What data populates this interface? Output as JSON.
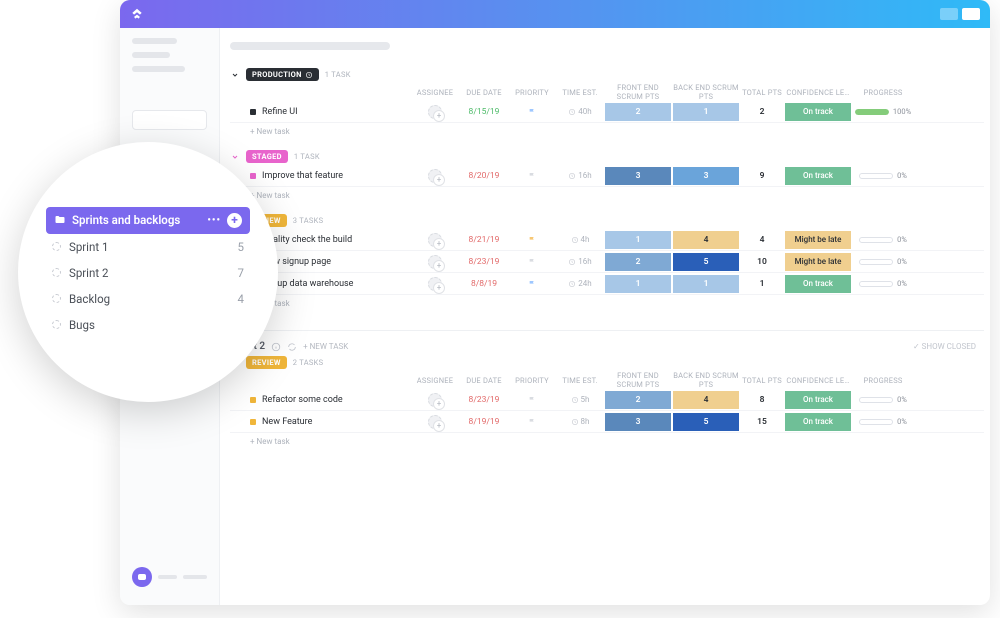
{
  "columns": {
    "assignee": "ASSIGNEE",
    "due": "DUE DATE",
    "priority": "PRIORITY",
    "time": "TIME EST.",
    "fe": "FRONT END SCRUM PTS",
    "be": "BACK END SCRUM PTS",
    "total": "TOTAL PTS",
    "conf": "CONFIDENCE LE…",
    "prog": "PROGRESS"
  },
  "new_task": "+ New task",
  "sprint1_groups": [
    {
      "pill": "PRODUCTION",
      "pill_color": "#2a2e34",
      "pill_arrow": "#2a2e34",
      "count": "1 TASK",
      "tasks": [
        {
          "dot": "#2a2e34",
          "title": "Refine UI",
          "due": "8/15/19",
          "due_cls": "date-green",
          "flag": "#9ec7ff",
          "time": "40h",
          "fe": {
            "v": "2",
            "cls": "fe-lt"
          },
          "be": {
            "v": "1",
            "cls": "be-lt"
          },
          "total": "2",
          "conf": "On track",
          "conf_cls": "conf-track",
          "prog": 100,
          "prog_txt": "100%"
        }
      ]
    },
    {
      "pill": "STAGED",
      "pill_color": "#e864cc",
      "pill_arrow": "#e864cc",
      "count": "1 TASK",
      "tasks": [
        {
          "dot": "#e864cc",
          "title": "Improve that feature",
          "due": "8/20/19",
          "due_cls": "date-red",
          "flag": "#d9dce1",
          "time": "16h",
          "fe": {
            "v": "3",
            "cls": "fe-dk"
          },
          "be": {
            "v": "3",
            "cls": "be-md"
          },
          "total": "9",
          "conf": "On track",
          "conf_cls": "conf-track",
          "prog": 0,
          "prog_txt": "0%"
        }
      ]
    },
    {
      "pill": "REVIEW",
      "pill_color": "#f0b63a",
      "pill_arrow": "#f0b63a",
      "count": "3 TASKS",
      "tasks": [
        {
          "dot": "#f0b63a",
          "title": "Quality check the build",
          "due": "8/21/19",
          "due_cls": "date-red",
          "flag": "#f7c774",
          "time": "4h",
          "fe": {
            "v": "1",
            "cls": "fe-lt"
          },
          "be": {
            "v": "4",
            "cls": "be-yl"
          },
          "total": "4",
          "conf": "Might be late",
          "conf_cls": "conf-late",
          "prog": 0,
          "prog_txt": "0%"
        },
        {
          "dot": "#f0b63a",
          "title": "New signup page",
          "due": "8/23/19",
          "due_cls": "date-red",
          "flag": "#d9dce1",
          "time": "16h",
          "fe": {
            "v": "2",
            "cls": "fe-md"
          },
          "be": {
            "v": "5",
            "cls": "be-dk"
          },
          "total": "10",
          "conf": "Might be late",
          "conf_cls": "conf-late",
          "prog": 0,
          "prog_txt": "0%"
        },
        {
          "dot": "#f0b63a",
          "title": "Set up data warehouse",
          "due": "8/8/19",
          "due_cls": "date-red",
          "flag": "#9ec7ff",
          "time": "24h",
          "fe": {
            "v": "1",
            "cls": "fe-lt"
          },
          "be": {
            "v": "1",
            "cls": "be-lt"
          },
          "total": "1",
          "conf": "On track",
          "conf_cls": "conf-track",
          "prog": 0,
          "prog_txt": "0%"
        }
      ]
    }
  ],
  "sprint2": {
    "title": "Sprint 2",
    "new_task": "+ NEW TASK",
    "show_closed": "✓ SHOW CLOSED",
    "groups": [
      {
        "pill": "REVIEW",
        "pill_color": "#f0b63a",
        "pill_arrow": "#f0b63a",
        "count": "2 TASKS",
        "tasks": [
          {
            "dot": "#f0b63a",
            "title": "Refactor some code",
            "due": "8/23/19",
            "due_cls": "date-red",
            "flag": "#d9dce1",
            "time": "5h",
            "fe": {
              "v": "2",
              "cls": "fe-md"
            },
            "be": {
              "v": "4",
              "cls": "be-yl"
            },
            "total": "8",
            "conf": "On track",
            "conf_cls": "conf-track",
            "prog": 0,
            "prog_txt": "0%"
          },
          {
            "dot": "#f0b63a",
            "title": "New Feature",
            "due": "8/19/19",
            "due_cls": "date-red",
            "flag": "#d9dce1",
            "time": "8h",
            "fe": {
              "v": "3",
              "cls": "fe-dk"
            },
            "be": {
              "v": "5",
              "cls": "be-dk"
            },
            "total": "15",
            "conf": "On track",
            "conf_cls": "conf-track",
            "prog": 0,
            "prog_txt": "0%"
          }
        ]
      }
    ]
  },
  "zoom": {
    "folder": "Sprints and backlogs",
    "items": [
      {
        "label": "Sprint 1",
        "count": "5"
      },
      {
        "label": "Sprint 2",
        "count": "7"
      },
      {
        "label": "Backlog",
        "count": "4"
      },
      {
        "label": "Bugs",
        "count": ""
      }
    ]
  }
}
